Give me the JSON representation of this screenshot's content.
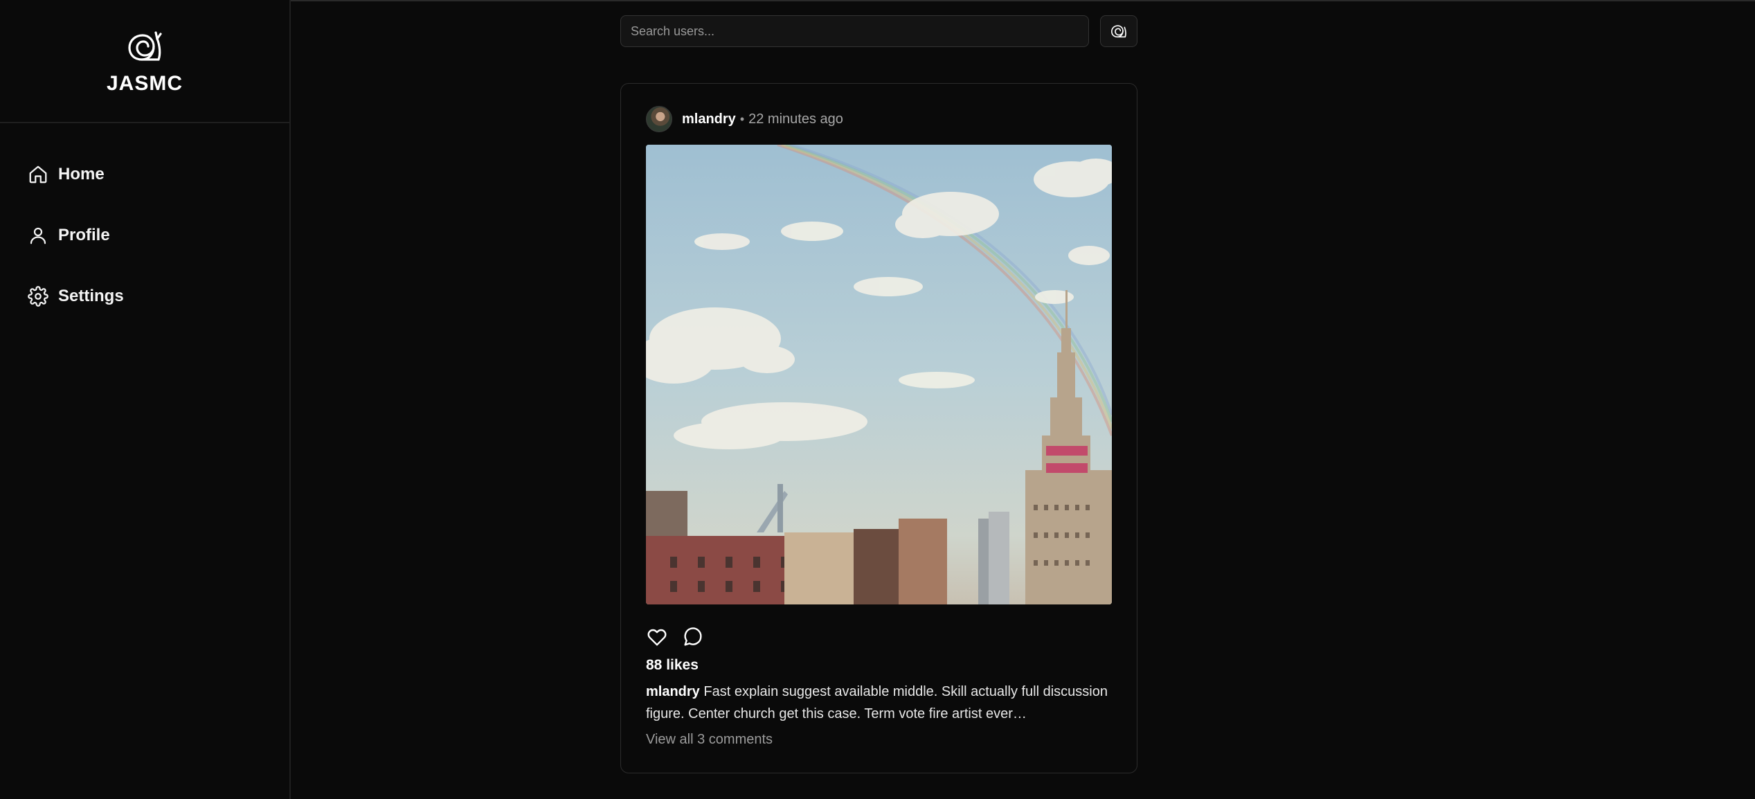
{
  "app": {
    "brand_name": "JASMC",
    "logo_icon": "snail-icon"
  },
  "sidebar": {
    "items": [
      {
        "label": "Home",
        "icon": "home-icon"
      },
      {
        "label": "Profile",
        "icon": "user-icon"
      },
      {
        "label": "Settings",
        "icon": "gear-icon"
      }
    ]
  },
  "search": {
    "placeholder": "Search users...",
    "value": "",
    "button_icon": "snail-icon"
  },
  "post": {
    "username": "mlandry",
    "separator": "•",
    "time_ago": "22 minutes ago",
    "image_alt": "City skyline with rainbow",
    "likes_text": "88 likes",
    "caption_user": "mlandry",
    "caption_text": "Fast explain suggest available middle. Skill actually full discussion figure. Center church get this case. Term vote fire artist ever…",
    "view_comments": "View all 3 comments",
    "actions": [
      "heart-icon",
      "comment-icon"
    ]
  },
  "colors": {
    "background": "#0a0a0a",
    "border": "#2c2c2c",
    "text": "#f2f2f2",
    "muted": "#9c9c9c"
  }
}
